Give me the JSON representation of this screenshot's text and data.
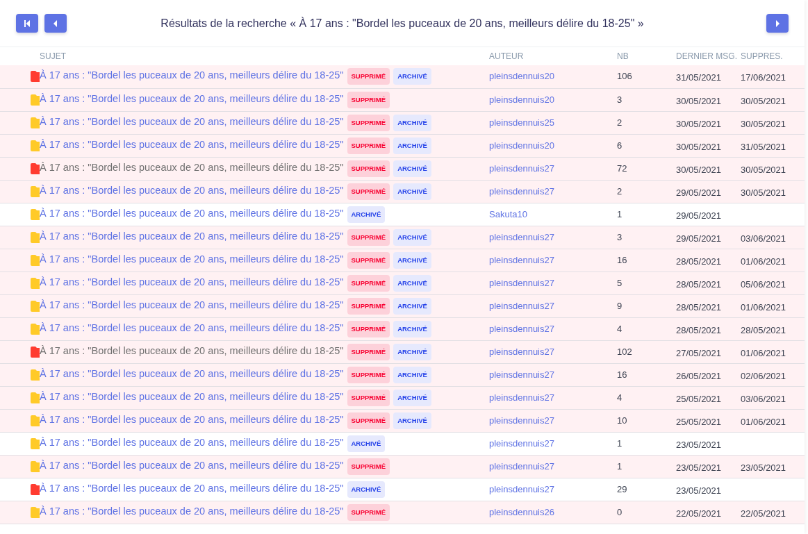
{
  "header": {
    "title": "Résultats de la recherche « À 17 ans : \"Bordel les puceaux de 20 ans, meilleurs délire du 18-25\" »"
  },
  "table": {
    "columns": [
      "SUJET",
      "AUTEUR",
      "NB",
      "DERNIER MSG.",
      "SUPPRES."
    ],
    "rows": [
      {
        "color": "#ff3b30",
        "visited": false,
        "subject": "À 17 ans : \"Bordel les puceaux de 20 ans, meilleurs délire du 18-25\"",
        "badges": [
          {
            "kind": "deleted",
            "label": "SUPPRIMÉ"
          },
          {
            "kind": "archived",
            "label": "ARCHIVÉ"
          }
        ],
        "author": "pleinsdennuis20",
        "nb": "106",
        "last": "31/05/2021",
        "deleted_on": "17/06/2021"
      },
      {
        "color": "#ffca28",
        "visited": false,
        "subject": "À 17 ans : \"Bordel les puceaux de 20 ans, meilleurs délire du 18-25\"",
        "badges": [
          {
            "kind": "deleted",
            "label": "SUPPRIMÉ"
          }
        ],
        "author": "pleinsdennuis20",
        "nb": "3",
        "last": "30/05/2021",
        "deleted_on": "30/05/2021"
      },
      {
        "color": "#ffca28",
        "visited": false,
        "subject": "À 17 ans : \"Bordel les puceaux de 20 ans, meilleurs délire du 18-25\"",
        "badges": [
          {
            "kind": "deleted",
            "label": "SUPPRIMÉ"
          },
          {
            "kind": "archived",
            "label": "ARCHIVÉ"
          }
        ],
        "author": "pleinsdennuis25",
        "nb": "2",
        "last": "30/05/2021",
        "deleted_on": "30/05/2021"
      },
      {
        "color": "#ffca28",
        "visited": false,
        "subject": "À 17 ans : \"Bordel les puceaux de 20 ans, meilleurs délire du 18-25\"",
        "badges": [
          {
            "kind": "deleted",
            "label": "SUPPRIMÉ"
          },
          {
            "kind": "archived",
            "label": "ARCHIVÉ"
          }
        ],
        "author": "pleinsdennuis20",
        "nb": "6",
        "last": "30/05/2021",
        "deleted_on": "31/05/2021"
      },
      {
        "color": "#ff3b30",
        "visited": true,
        "subject": "À 17 ans : \"Bordel les puceaux de 20 ans, meilleurs délire du 18-25\"",
        "badges": [
          {
            "kind": "deleted",
            "label": "SUPPRIMÉ"
          },
          {
            "kind": "archived",
            "label": "ARCHIVÉ"
          }
        ],
        "author": "pleinsdennuis27",
        "nb": "72",
        "last": "30/05/2021",
        "deleted_on": "30/05/2021"
      },
      {
        "color": "#ffca28",
        "visited": false,
        "subject": "À 17 ans : \"Bordel les puceaux de 20 ans, meilleurs délire du 18-25\"",
        "badges": [
          {
            "kind": "deleted",
            "label": "SUPPRIMÉ"
          },
          {
            "kind": "archived",
            "label": "ARCHIVÉ"
          }
        ],
        "author": "pleinsdennuis27",
        "nb": "2",
        "last": "29/05/2021",
        "deleted_on": "30/05/2021"
      },
      {
        "color": "#ffca28",
        "visited": false,
        "subject": "À 17 ans : \"Bordel les puceaux de 20 ans, meilleurs délire du 18-25\"",
        "badges": [
          {
            "kind": "archived",
            "label": "ARCHIVÉ"
          }
        ],
        "author": "Sakuta10",
        "nb": "1",
        "last": "29/05/2021"
      },
      {
        "color": "#ffca28",
        "visited": false,
        "subject": "À 17 ans : \"Bordel les puceaux de 20 ans, meilleurs délire du 18-25\"",
        "badges": [
          {
            "kind": "deleted",
            "label": "SUPPRIMÉ"
          },
          {
            "kind": "archived",
            "label": "ARCHIVÉ"
          }
        ],
        "author": "pleinsdennuis27",
        "nb": "3",
        "last": "29/05/2021",
        "deleted_on": "03/06/2021"
      },
      {
        "color": "#ffca28",
        "visited": false,
        "subject": "À 17 ans : \"Bordel les puceaux de 20 ans, meilleurs délire du 18-25\"",
        "badges": [
          {
            "kind": "deleted",
            "label": "SUPPRIMÉ"
          },
          {
            "kind": "archived",
            "label": "ARCHIVÉ"
          }
        ],
        "author": "pleinsdennuis27",
        "nb": "16",
        "last": "28/05/2021",
        "deleted_on": "01/06/2021"
      },
      {
        "color": "#ffca28",
        "visited": false,
        "subject": "À 17 ans : \"Bordel les puceaux de 20 ans, meilleurs délire du 18-25\"",
        "badges": [
          {
            "kind": "deleted",
            "label": "SUPPRIMÉ"
          },
          {
            "kind": "archived",
            "label": "ARCHIVÉ"
          }
        ],
        "author": "pleinsdennuis27",
        "nb": "5",
        "last": "28/05/2021",
        "deleted_on": "05/06/2021"
      },
      {
        "color": "#ffca28",
        "visited": false,
        "subject": "À 17 ans : \"Bordel les puceaux de 20 ans, meilleurs délire du 18-25\"",
        "badges": [
          {
            "kind": "deleted",
            "label": "SUPPRIMÉ"
          },
          {
            "kind": "archived",
            "label": "ARCHIVÉ"
          }
        ],
        "author": "pleinsdennuis27",
        "nb": "9",
        "last": "28/05/2021",
        "deleted_on": "01/06/2021"
      },
      {
        "color": "#ffca28",
        "visited": false,
        "subject": "À 17 ans : \"Bordel les puceaux de 20 ans, meilleurs délire du 18-25\"",
        "badges": [
          {
            "kind": "deleted",
            "label": "SUPPRIMÉ"
          },
          {
            "kind": "archived",
            "label": "ARCHIVÉ"
          }
        ],
        "author": "pleinsdennuis27",
        "nb": "4",
        "last": "28/05/2021",
        "deleted_on": "28/05/2021"
      },
      {
        "color": "#ff3b30",
        "visited": true,
        "subject": "À 17 ans : \"Bordel les puceaux de 20 ans, meilleurs délire du 18-25\"",
        "badges": [
          {
            "kind": "deleted",
            "label": "SUPPRIMÉ"
          },
          {
            "kind": "archived",
            "label": "ARCHIVÉ"
          }
        ],
        "author": "pleinsdennuis27",
        "nb": "102",
        "last": "27/05/2021",
        "deleted_on": "01/06/2021"
      },
      {
        "color": "#ffca28",
        "visited": false,
        "subject": "À 17 ans : \"Bordel les puceaux de 20 ans, meilleurs délire du 18-25\"",
        "badges": [
          {
            "kind": "deleted",
            "label": "SUPPRIMÉ"
          },
          {
            "kind": "archived",
            "label": "ARCHIVÉ"
          }
        ],
        "author": "pleinsdennuis27",
        "nb": "16",
        "last": "26/05/2021",
        "deleted_on": "02/06/2021"
      },
      {
        "color": "#ffca28",
        "visited": false,
        "subject": "À 17 ans : \"Bordel les puceaux de 20 ans, meilleurs délire du 18-25\"",
        "badges": [
          {
            "kind": "deleted",
            "label": "SUPPRIMÉ"
          },
          {
            "kind": "archived",
            "label": "ARCHIVÉ"
          }
        ],
        "author": "pleinsdennuis27",
        "nb": "4",
        "last": "25/05/2021",
        "deleted_on": "03/06/2021"
      },
      {
        "color": "#ffca28",
        "visited": false,
        "subject": "À 17 ans : \"Bordel les puceaux de 20 ans, meilleurs délire du 18-25\"",
        "badges": [
          {
            "kind": "deleted",
            "label": "SUPPRIMÉ"
          },
          {
            "kind": "archived",
            "label": "ARCHIVÉ"
          }
        ],
        "author": "pleinsdennuis27",
        "nb": "10",
        "last": "25/05/2021",
        "deleted_on": "01/06/2021"
      },
      {
        "color": "#ffca28",
        "visited": false,
        "subject": "À 17 ans : \"Bordel les puceaux de 20 ans, meilleurs délire du 18-25\"",
        "badges": [
          {
            "kind": "archived",
            "label": "ARCHIVÉ"
          }
        ],
        "author": "pleinsdennuis27",
        "nb": "1",
        "last": "23/05/2021"
      },
      {
        "color": "#ffca28",
        "visited": false,
        "subject": "À 17 ans : \"Bordel les puceaux de 20 ans, meilleurs délire du 18-25\"",
        "badges": [
          {
            "kind": "deleted",
            "label": "SUPPRIMÉ"
          }
        ],
        "author": "pleinsdennuis27",
        "nb": "1",
        "last": "23/05/2021",
        "deleted_on": "23/05/2021"
      },
      {
        "color": "#ff3b30",
        "visited": false,
        "subject": "À 17 ans : \"Bordel les puceaux de 20 ans, meilleurs délire du 18-25\"",
        "badges": [
          {
            "kind": "archived",
            "label": "ARCHIVÉ"
          }
        ],
        "author": "pleinsdennuis27",
        "nb": "29",
        "last": "23/05/2021"
      },
      {
        "color": "#ffca28",
        "visited": false,
        "subject": "À 17 ans : \"Bordel les puceaux de 20 ans, meilleurs délire du 18-25\"",
        "badges": [
          {
            "kind": "deleted",
            "label": "SUPPRIMÉ"
          }
        ],
        "author": "pleinsdennuis26",
        "nb": "0",
        "last": "22/05/2021",
        "deleted_on": "22/05/2021"
      }
    ]
  }
}
